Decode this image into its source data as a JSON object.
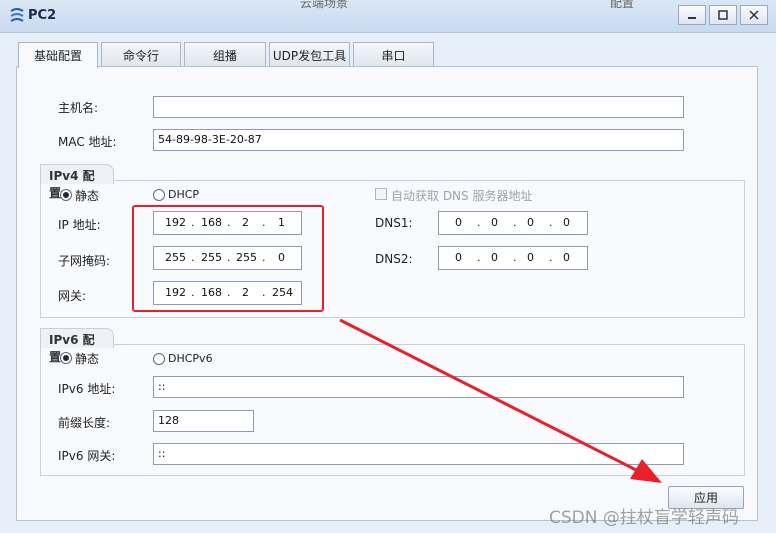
{
  "window": {
    "title": "PC2",
    "top_fragment_left": "云端场景",
    "top_fragment_right": "配置"
  },
  "tabs": [
    {
      "label": "基础配置",
      "active": true
    },
    {
      "label": "命令行",
      "active": false
    },
    {
      "label": "组播",
      "active": false
    },
    {
      "label": "UDP发包工具",
      "active": false
    },
    {
      "label": "串口",
      "active": false
    }
  ],
  "basic": {
    "hostname_label": "主机名:",
    "hostname_value": "",
    "mac_label": "MAC 地址:",
    "mac_value": "54-89-98-3E-20-87"
  },
  "ipv4": {
    "group_title": "IPv4 配置",
    "static_label": "静态",
    "dhcp_label": "DHCP",
    "mode": "static",
    "auto_dns_label": "自动获取 DNS 服务器地址",
    "ip_label": "IP 地址:",
    "ip": [
      "192",
      "168",
      "2",
      "1"
    ],
    "mask_label": "子网掩码:",
    "mask": [
      "255",
      "255",
      "255",
      "0"
    ],
    "gateway_label": "网关:",
    "gateway": [
      "192",
      "168",
      "2",
      "254"
    ],
    "dns1_label": "DNS1:",
    "dns1": [
      "0",
      "0",
      "0",
      "0"
    ],
    "dns2_label": "DNS2:",
    "dns2": [
      "0",
      "0",
      "0",
      "0"
    ],
    "dot": "."
  },
  "ipv6": {
    "group_title": "IPv6 配置",
    "static_label": "静态",
    "dhcp_label": "DHCPv6",
    "mode": "static",
    "address_label": "IPv6 地址:",
    "address_value": "::",
    "prefix_label": "前缀长度:",
    "prefix_value": "128",
    "gateway_label": "IPv6 网关:",
    "gateway_value": "::"
  },
  "apply_label": "应用",
  "watermark": "CSDN @拄杖盲学轻声码",
  "annotation_color": "#e8202a"
}
